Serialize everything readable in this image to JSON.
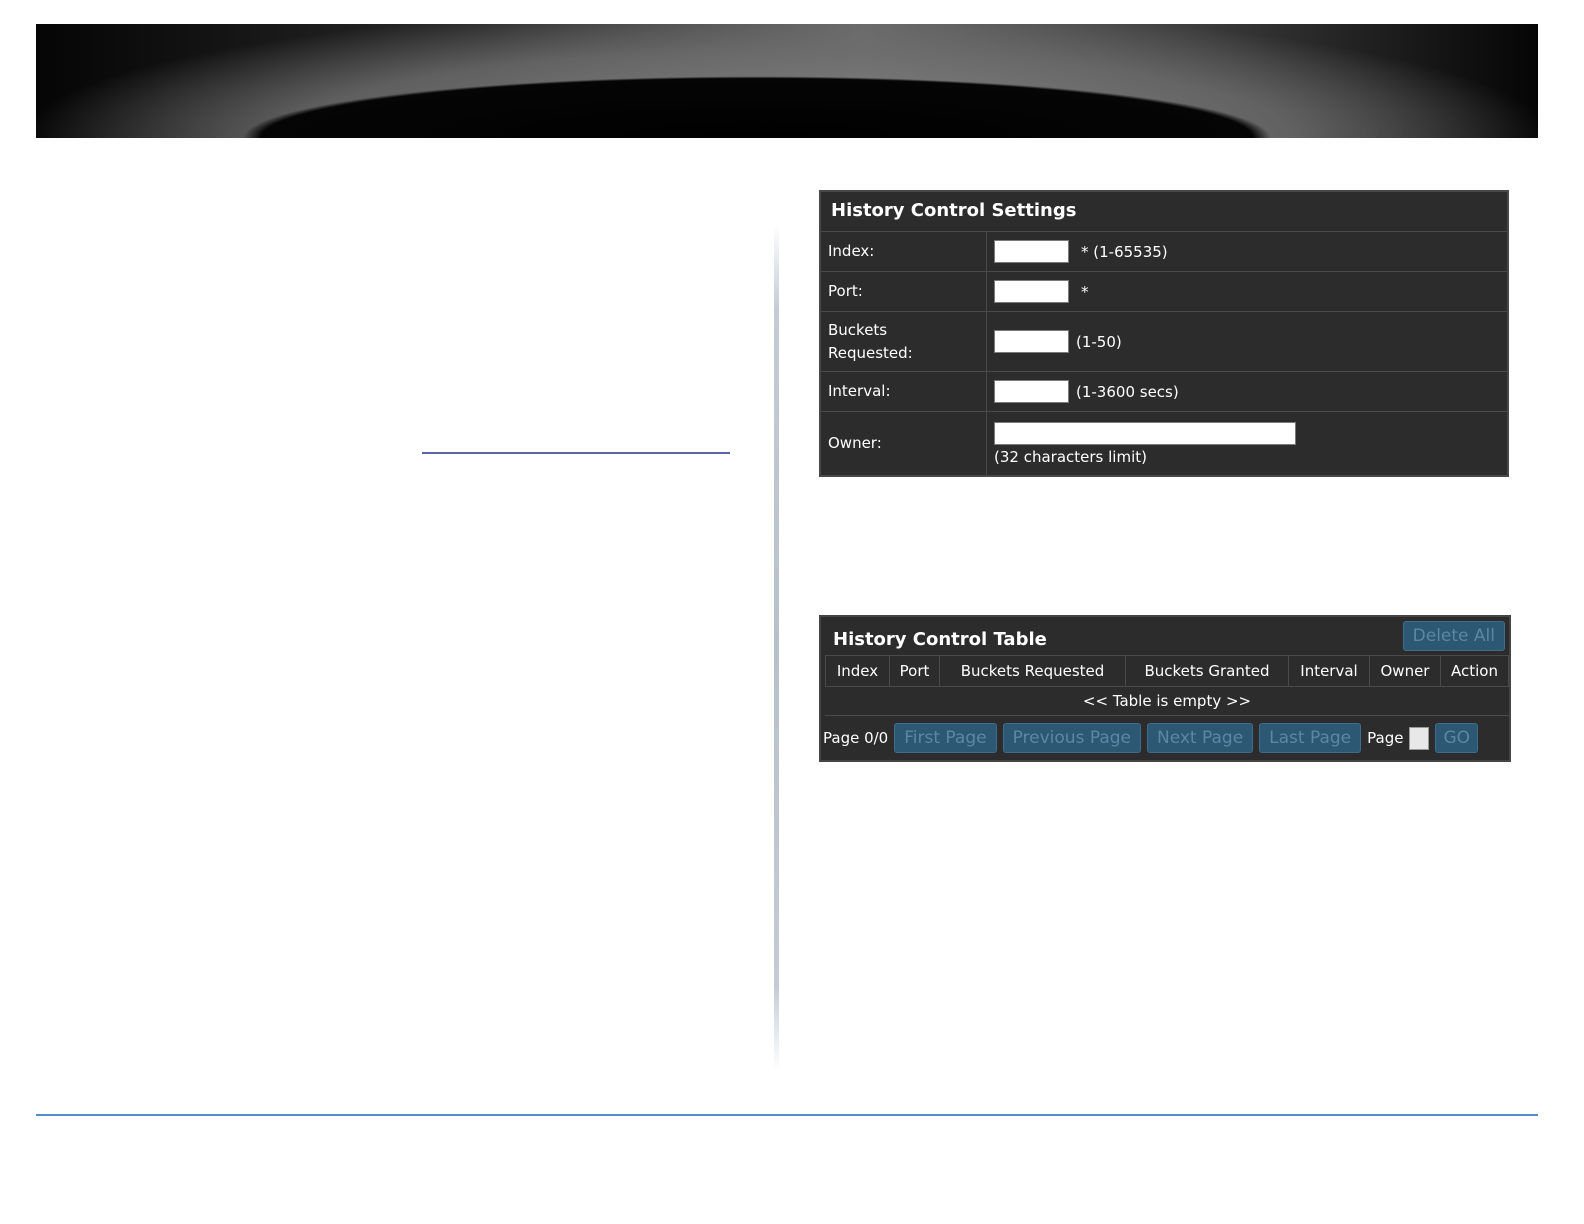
{
  "settings": {
    "title": "History Control Settings",
    "rows": {
      "index": {
        "label": "Index:",
        "value": "",
        "hint": "* (1-65535)"
      },
      "port": {
        "label": "Port:",
        "value": "",
        "hint": "*"
      },
      "buckets": {
        "label": "Buckets Requested:",
        "value": "",
        "hint": "(1-50)"
      },
      "interval": {
        "label": "Interval:",
        "value": "",
        "hint": "(1-3600 secs)"
      },
      "owner": {
        "label": "Owner:",
        "value": "",
        "hint": "(32 characters limit)"
      }
    }
  },
  "table": {
    "title": "History Control Table",
    "delete_all_label": "Delete All",
    "columns": [
      "Index",
      "Port",
      "Buckets Requested",
      "Buckets Granted",
      "Interval",
      "Owner",
      "Action"
    ],
    "empty_text": "<< Table is empty >>",
    "pager": {
      "status": "Page 0/0",
      "first": "First Page",
      "previous": "Previous Page",
      "next": "Next Page",
      "last": "Last Page",
      "page_label": "Page",
      "page_value": "",
      "go": "GO"
    }
  },
  "colors": {
    "panel_bg": "#2c2c2c",
    "button_bg": "#2c5874",
    "button_text": "#5b87a4",
    "footer_line": "#4f8fc8"
  }
}
